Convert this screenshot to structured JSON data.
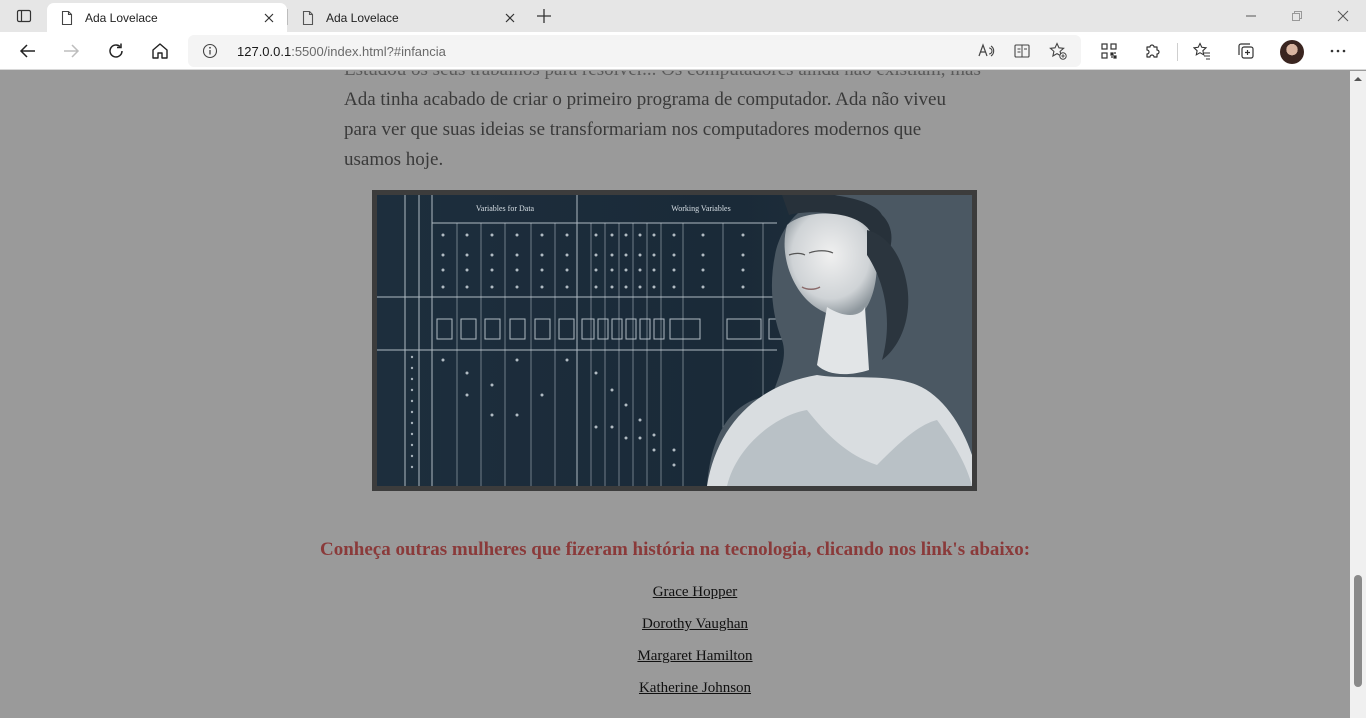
{
  "browser": {
    "tabs": [
      {
        "title": "Ada Lovelace",
        "active": true
      },
      {
        "title": "Ada Lovelace",
        "active": false
      }
    ],
    "url_host": "127.0.0.1",
    "url_rest": ":5500/index.html?#infancia"
  },
  "page": {
    "paragraph_lines": [
      "Estudou os seus trabalhos para resolver... Os computadores ainda não existiam, mas",
      "Ada tinha acabado de criar o primeiro programa de computador. Ada não viveu",
      "para ver que suas ideias se transformariam nos computadores modernos que",
      "usamos hoje."
    ],
    "image_caption_lettering": {
      "header_left": "Variables for Data",
      "header_right": "Working Variables"
    },
    "heading": "Conheça outras mulheres que fizeram história na tecnologia, clicando nos link's abaixo:",
    "links": [
      {
        "label": "Grace Hopper"
      },
      {
        "label": "Dorothy Vaughan"
      },
      {
        "label": "Margaret Hamilton"
      },
      {
        "label": "Katherine Johnson"
      }
    ]
  },
  "colors": {
    "page_background": "#9a9a9a",
    "heading": "#8a3a3a"
  }
}
